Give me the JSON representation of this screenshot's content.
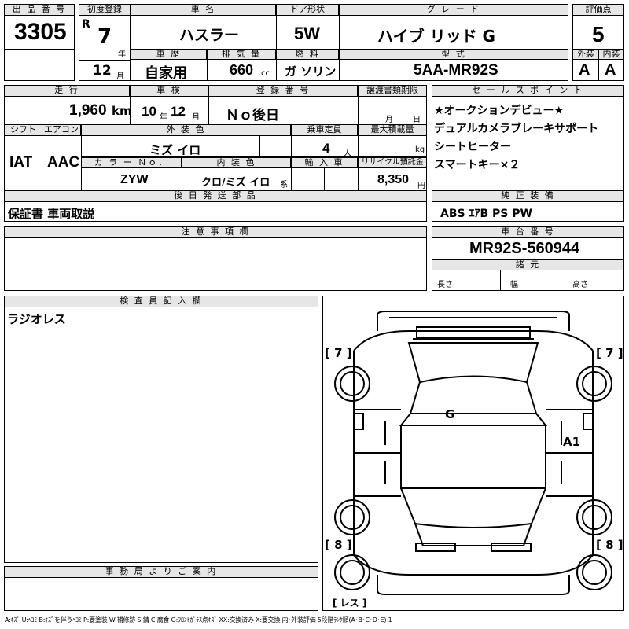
{
  "headers": {
    "lot_number": "出 品 番 号",
    "first_reg": "初度登録",
    "car_name": "車 名",
    "door": "ドア形状",
    "grade": "グ レ ー ド",
    "score": "評価点",
    "history": "車 歴",
    "displacement": "排 気 量",
    "fuel": "燃 料",
    "model": "型 式",
    "exterior": "外装",
    "interior": "内装",
    "mileage": "走 行",
    "inspection": "車 検",
    "registration": "登 録 番 号",
    "transfer": "譲渡書類期限",
    "selling_points": "セ ー ル ス ポ イ ン ト",
    "shift": "シフト",
    "aircon": "エアコン",
    "ext_color": "外 装 色",
    "capacity": "乗車定員",
    "max_load": "最大積載量",
    "color_no": "カ ラ ー Ｎｏ．",
    "int_color": "内 装 色",
    "import": "輸 入 車",
    "recycle": "リサイクル預託金",
    "later_parts": "後 日 発 送 部 品",
    "genuine_equipment": "純 正 装 備",
    "notes": "注 意 事 項 欄",
    "chassis": "車 台 番 号",
    "specs": "諸 元",
    "inspector": "検 査 員 記 入 欄",
    "office": "事 務 局 よ り ご 案 内"
  },
  "vehicle": {
    "lot_number": "3305",
    "era": "R",
    "year": "7",
    "year_unit": "年",
    "month": "12",
    "month_unit": "月",
    "car_name": "ハスラー",
    "door": "5W",
    "grade": "ハイブ リッド G",
    "score": "5",
    "history": "自家用",
    "displacement": "660",
    "displacement_unit": "cc",
    "fuel": "ガ ソリン",
    "model": "5AA-MR92S",
    "exterior_score": "A",
    "interior_score": "A",
    "mileage": "1,960",
    "mileage_unit": "km",
    "inspection_year": "10",
    "inspection_year_unit": "年",
    "inspection_month": "12",
    "inspection_month_unit": "月",
    "registration": "Ｎｏ後日",
    "transfer_month": "月",
    "transfer_day": "日",
    "shift": "IAT",
    "aircon": "AAC",
    "ext_color": "ミズ イロ",
    "capacity": "4",
    "capacity_unit": "人",
    "max_load_unit": "kg",
    "color_no": "ZYW",
    "int_color": "クロ/ミズ イロ",
    "int_color_suffix": "系",
    "recycle": "8,350",
    "recycle_unit": "円",
    "later_parts": "保証書 車両取説",
    "genuine_equipment": "ABS ｴｱB PS PW",
    "chassis": "MR92S-560944",
    "length_label": "長さ",
    "width_label": "幅",
    "height_label": "高さ",
    "inspector_note": "ラジオレス"
  },
  "selling_points": [
    "★オークションデビュー★",
    "デュアルカメラブレーキサポート",
    "シートヒーター",
    "スマートキー×２"
  ],
  "diagram": {
    "tl": "[ 7 ]",
    "tr": "[ 7 ]",
    "bl": "[ 8 ]",
    "br": "[ 8 ]",
    "glass_mark": "G",
    "door_mark": "A1",
    "radio": "[ レス ]"
  },
  "legend": "A:ｷｽﾞ U:ﾍｺﾐ B:ｷｽﾞを伴うﾍｺﾐ P:要塗装 W:補修跡 S:錆 C:腐食 G:ﾌﾛﾝﾄｶﾞﾗｽ点ｷｽﾞ XX:交換済み X:要交換  内･外装評価 5段階ﾗﾝｸ順(A･B･C･D･E) 1"
}
